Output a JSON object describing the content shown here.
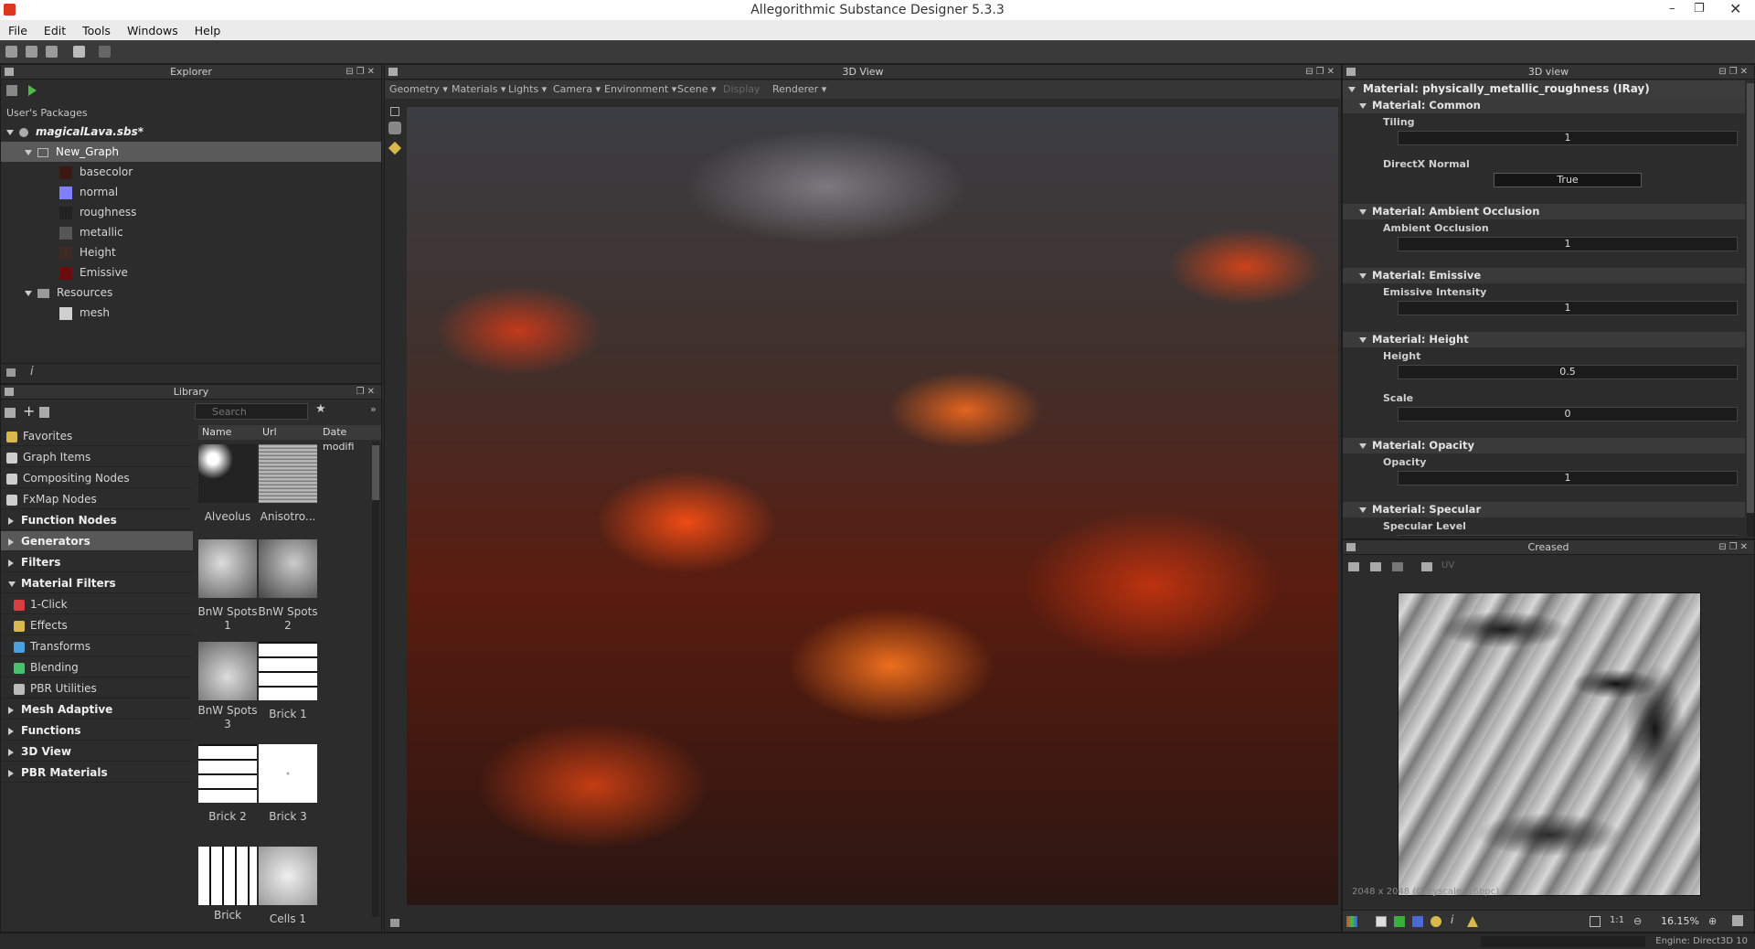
{
  "window": {
    "title": "Allegorithmic Substance Designer 5.3.3"
  },
  "menu": [
    "File",
    "Edit",
    "Tools",
    "Windows",
    "Help"
  ],
  "explorer": {
    "title": "Explorer",
    "section": "User's Packages",
    "package": "magicalLava.sbs*",
    "graph": "New_Graph",
    "outputs": [
      "basecolor",
      "normal",
      "roughness",
      "metallic",
      "Height",
      "Emissive"
    ],
    "resources_label": "Resources",
    "resource_items": [
      "mesh"
    ]
  },
  "library": {
    "title": "Library",
    "search_placeholder": "Search",
    "columns": [
      "Name",
      "Url",
      "Date modifi"
    ],
    "categories": [
      {
        "label": "Favorites",
        "bold": false,
        "icon": "star-icon",
        "color": "#d8b84a"
      },
      {
        "label": "Graph Items",
        "bold": false,
        "icon": "graph-items-icon",
        "color": "#cfcfcf"
      },
      {
        "label": "Compositing Nodes",
        "bold": false,
        "icon": "compositing-nodes-icon",
        "color": "#cfcfcf"
      },
      {
        "label": "FxMap Nodes",
        "bold": false,
        "icon": "fxmap-nodes-icon",
        "color": "#cfcfcf"
      },
      {
        "label": "Function Nodes",
        "bold": true,
        "icon": "",
        "color": ""
      },
      {
        "label": "Generators",
        "bold": true,
        "icon": "",
        "color": ""
      },
      {
        "label": "Filters",
        "bold": true,
        "icon": "",
        "color": ""
      },
      {
        "label": "Material Filters",
        "bold": true,
        "icon": "",
        "color": ""
      },
      {
        "label": "1-Click",
        "bold": false,
        "icon": "one-click-icon",
        "color": "#d84040"
      },
      {
        "label": "Effects",
        "bold": false,
        "icon": "effects-icon",
        "color": "#d8b84a"
      },
      {
        "label": "Transforms",
        "bold": false,
        "icon": "transforms-icon",
        "color": "#4aa0e0"
      },
      {
        "label": "Blending",
        "bold": false,
        "icon": "blending-icon",
        "color": "#48c070"
      },
      {
        "label": "PBR Utilities",
        "bold": false,
        "icon": "pbr-utilities-icon",
        "color": "#bbbbbb"
      },
      {
        "label": "Mesh Adaptive",
        "bold": true,
        "icon": "",
        "color": ""
      },
      {
        "label": "Functions",
        "bold": true,
        "icon": "",
        "color": ""
      },
      {
        "label": "3D View",
        "bold": true,
        "icon": "",
        "color": ""
      },
      {
        "label": "PBR Materials",
        "bold": true,
        "icon": "",
        "color": ""
      }
    ],
    "thumbnails": [
      {
        "label": "Alveolus"
      },
      {
        "label": "Anisotro..."
      },
      {
        "label": "BnW Spots 1"
      },
      {
        "label": "BnW Spots 2"
      },
      {
        "label": "BnW Spots 3"
      },
      {
        "label": "Brick 1"
      },
      {
        "label": "Brick 2"
      },
      {
        "label": "Brick 3"
      },
      {
        "label": "Brick"
      },
      {
        "label": "Cells 1"
      }
    ]
  },
  "view3d": {
    "title": "3D View",
    "menus": [
      "Geometry",
      "Materials",
      "Lights",
      "Camera",
      "Environment",
      "Scene",
      "Display",
      "Renderer"
    ]
  },
  "properties": {
    "title": "3D view",
    "material": "Material: physically_metallic_roughness (IRay)",
    "sections": [
      {
        "title": "Material: Common",
        "params": [
          {
            "label": "Tiling",
            "value": "1"
          },
          {
            "label": "DirectX Normal",
            "value": "True"
          }
        ]
      },
      {
        "title": "Material: Ambient Occlusion",
        "params": [
          {
            "label": "Ambient Occlusion",
            "value": "1"
          }
        ]
      },
      {
        "title": "Material: Emissive",
        "params": [
          {
            "label": "Emissive Intensity",
            "value": "1"
          }
        ]
      },
      {
        "title": "Material: Height",
        "params": [
          {
            "label": "Height",
            "value": "0.5"
          },
          {
            "label": "Scale",
            "value": "0"
          }
        ]
      },
      {
        "title": "Material: Opacity",
        "params": [
          {
            "label": "Opacity",
            "value": "1"
          }
        ]
      },
      {
        "title": "Material: Specular",
        "params": [
          {
            "label": "Specular Level",
            "value": ""
          }
        ]
      }
    ]
  },
  "view2d": {
    "title": "Creased",
    "uv_label": "UV",
    "info": "2048 x 2048 (Grayscale, 16bpc)",
    "ratio": "1:1",
    "zoom": "16.15%"
  },
  "status": {
    "engine": "Engine: Direct3D 10"
  }
}
